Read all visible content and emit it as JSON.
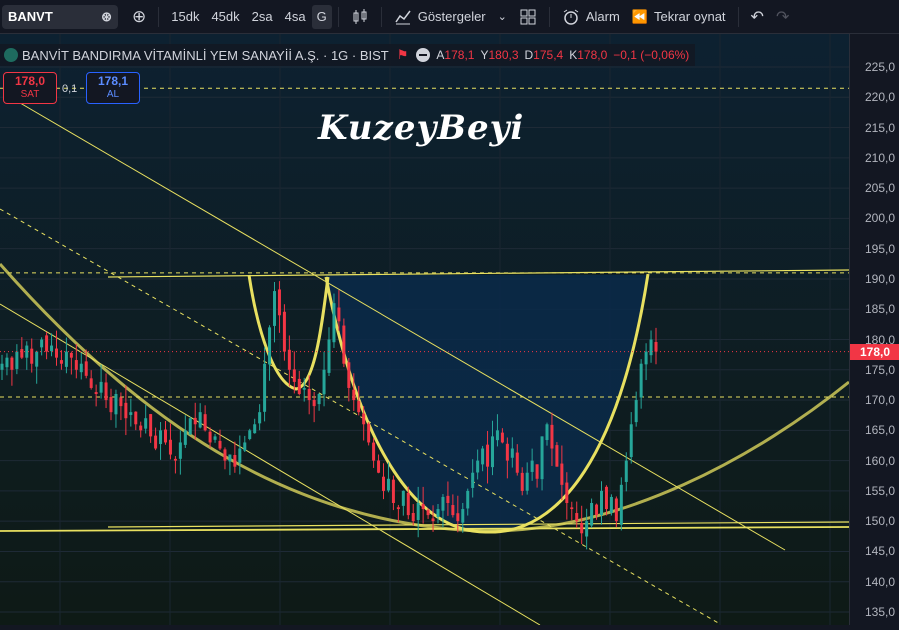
{
  "toolbar": {
    "symbol": "BANVT",
    "timeframes": [
      "15dk",
      "45dk",
      "2sa",
      "4sa",
      "G"
    ],
    "active_timeframe": "G",
    "indicators_label": "Göstergeler",
    "alarm_label": "Alarm",
    "replay_label": "Tekrar oynat"
  },
  "legend": {
    "title": "BANVİT BANDIRMA VİTAMİNLİ YEM SANAYİİ A.Ş. · 1G · BIST",
    "open_key": "A",
    "open": "178,1",
    "high_key": "Y",
    "high": "180,3",
    "low_key": "D",
    "low": "175,4",
    "close_key": "K",
    "close": "178,0",
    "change": "−0,1 (−0,06%)"
  },
  "trade": {
    "sell_price": "178,0",
    "sell_label": "SAT",
    "spread": "0,1",
    "buy_price": "178,1",
    "buy_label": "AL"
  },
  "watermark": "KuzeyBeyi",
  "price_axis": {
    "ticks": [
      "225,0",
      "220,0",
      "215,0",
      "210,0",
      "205,0",
      "200,0",
      "195,0",
      "190,0",
      "185,0",
      "180,0",
      "175,0",
      "170,0",
      "165,0",
      "160,0",
      "155,0",
      "150,0",
      "145,0",
      "140,0",
      "135,0"
    ],
    "current_price": "178,0"
  },
  "colors": {
    "up": "#26a69a",
    "down": "#f23645",
    "drawing": "#e8e060",
    "accent": "#2962ff",
    "background": "#131722"
  },
  "chart_data": {
    "type": "candlestick",
    "ylim": [
      133,
      228
    ],
    "current_price": 178.0,
    "horizontal_levels": [
      221.5,
      191,
      170.5
    ],
    "closes": [
      176,
      177,
      175,
      178,
      177,
      179,
      176,
      178,
      180,
      178,
      179,
      177,
      176,
      178,
      177,
      175,
      176,
      174,
      172,
      171,
      173,
      170,
      168,
      171,
      169,
      167,
      168,
      166,
      165,
      167,
      164,
      162,
      165,
      163,
      161,
      160,
      163,
      165,
      167,
      166,
      168,
      165,
      163,
      164,
      162,
      160,
      161,
      159,
      162,
      163,
      165,
      166,
      168,
      176,
      182,
      188,
      184,
      178,
      175,
      173,
      171,
      172,
      170,
      169,
      171,
      175,
      180,
      186,
      183,
      176,
      172,
      170,
      168,
      166,
      163,
      160,
      158,
      155,
      157,
      153,
      152,
      155,
      151,
      150,
      153,
      152,
      151,
      150,
      152,
      154,
      153,
      151,
      150,
      152,
      155,
      158,
      160,
      162,
      159,
      164,
      165,
      163,
      160,
      162,
      158,
      155,
      158,
      160,
      157,
      164,
      166,
      162,
      159,
      156,
      153,
      152,
      150,
      148,
      150,
      153,
      151,
      155,
      152,
      154,
      150,
      156,
      160,
      166,
      170,
      176,
      178,
      180,
      178
    ]
  }
}
